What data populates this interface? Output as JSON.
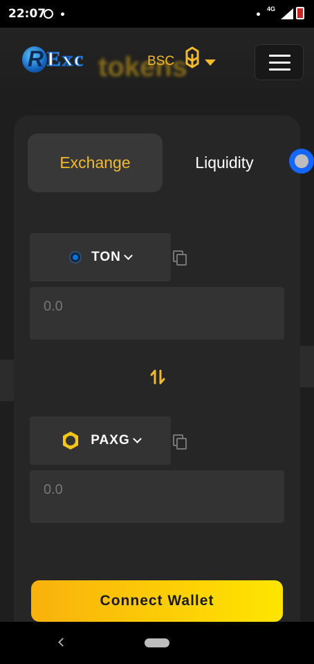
{
  "status_bar": {
    "time": "22:07",
    "network_type": "4G",
    "icons": [
      "sync-ring-icon",
      "notification-dot-icon",
      "signal-icon",
      "battery-low-icon"
    ]
  },
  "header": {
    "logo_text": "Exc",
    "logo_subtext": "tokens",
    "network": "BSC",
    "network_icon": "bnb-icon",
    "menu_icon": "hamburger-menu-icon"
  },
  "tabs": [
    {
      "label": "Exchange",
      "active": true
    },
    {
      "label": "Liquidity",
      "active": false
    }
  ],
  "swap": {
    "from": {
      "token": "TON",
      "icon": "ton-icon",
      "amount_placeholder": "0.0"
    },
    "to": {
      "token": "PAXG",
      "icon": "paxg-icon",
      "amount_placeholder": "0.0"
    },
    "swap_icon": "swap-arrows-icon"
  },
  "connect_button": {
    "label": "Connect Wallet"
  },
  "colors": {
    "accent": "#f3ba2f",
    "background": "#1e1e1e",
    "card": "#262626",
    "field": "#333333",
    "button_gradient_start": "#f9b10d",
    "button_gradient_end": "#ffe500"
  }
}
